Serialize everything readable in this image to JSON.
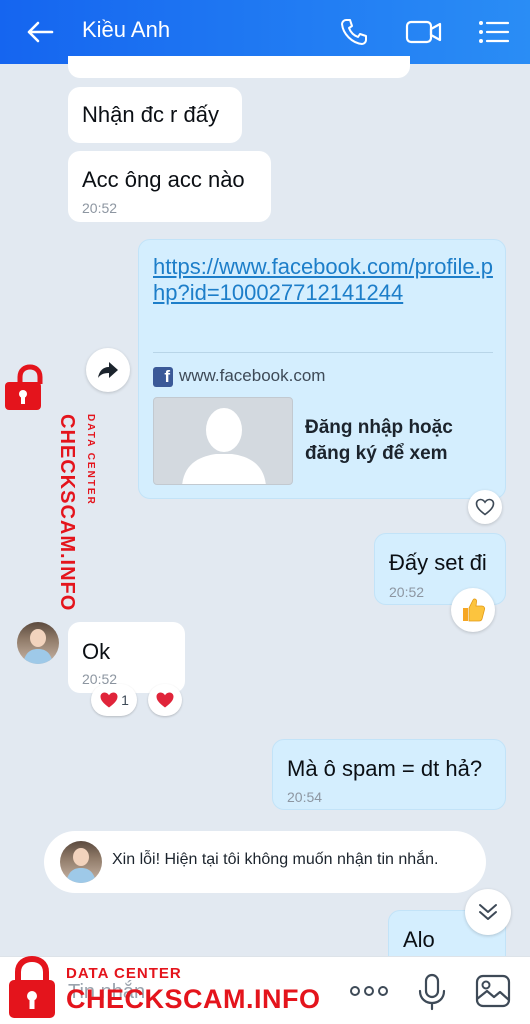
{
  "header": {
    "contact_name": "Kiều Anh",
    "icons": [
      "back-arrow-icon",
      "phone-icon",
      "video-call-icon",
      "menu-list-icon"
    ],
    "accent": "#1565f0"
  },
  "messages": {
    "m1": {
      "text": "Nhận đc r đấy"
    },
    "m2": {
      "text": "Acc ông acc nào",
      "time": "20:52"
    },
    "m3": {
      "link": "https://www.facebook.com/profile.php?id=100027712141244",
      "domain": "www.facebook.com",
      "card_title": "Đăng nhập hoặc đăng ký để xem"
    },
    "m4": {
      "text": "Đấy set đi",
      "time": "20:52",
      "reaction": "thumbs-up"
    },
    "m5": {
      "text": "Ok",
      "time": "20:52",
      "reaction_count": "1"
    },
    "m6": {
      "text": "Mà ô spam = dt hả?",
      "time": "20:54"
    },
    "m7": {
      "text": "Alo"
    }
  },
  "notice": {
    "text": "Xin lỗi! Hiện tại tôi không muốn nhận tin nhắn."
  },
  "input": {
    "placeholder": "Tin nhắn"
  },
  "watermark": {
    "small": "DATA CENTER",
    "big": "CHECKSCAM.INFO",
    "color": "#e4141c"
  }
}
